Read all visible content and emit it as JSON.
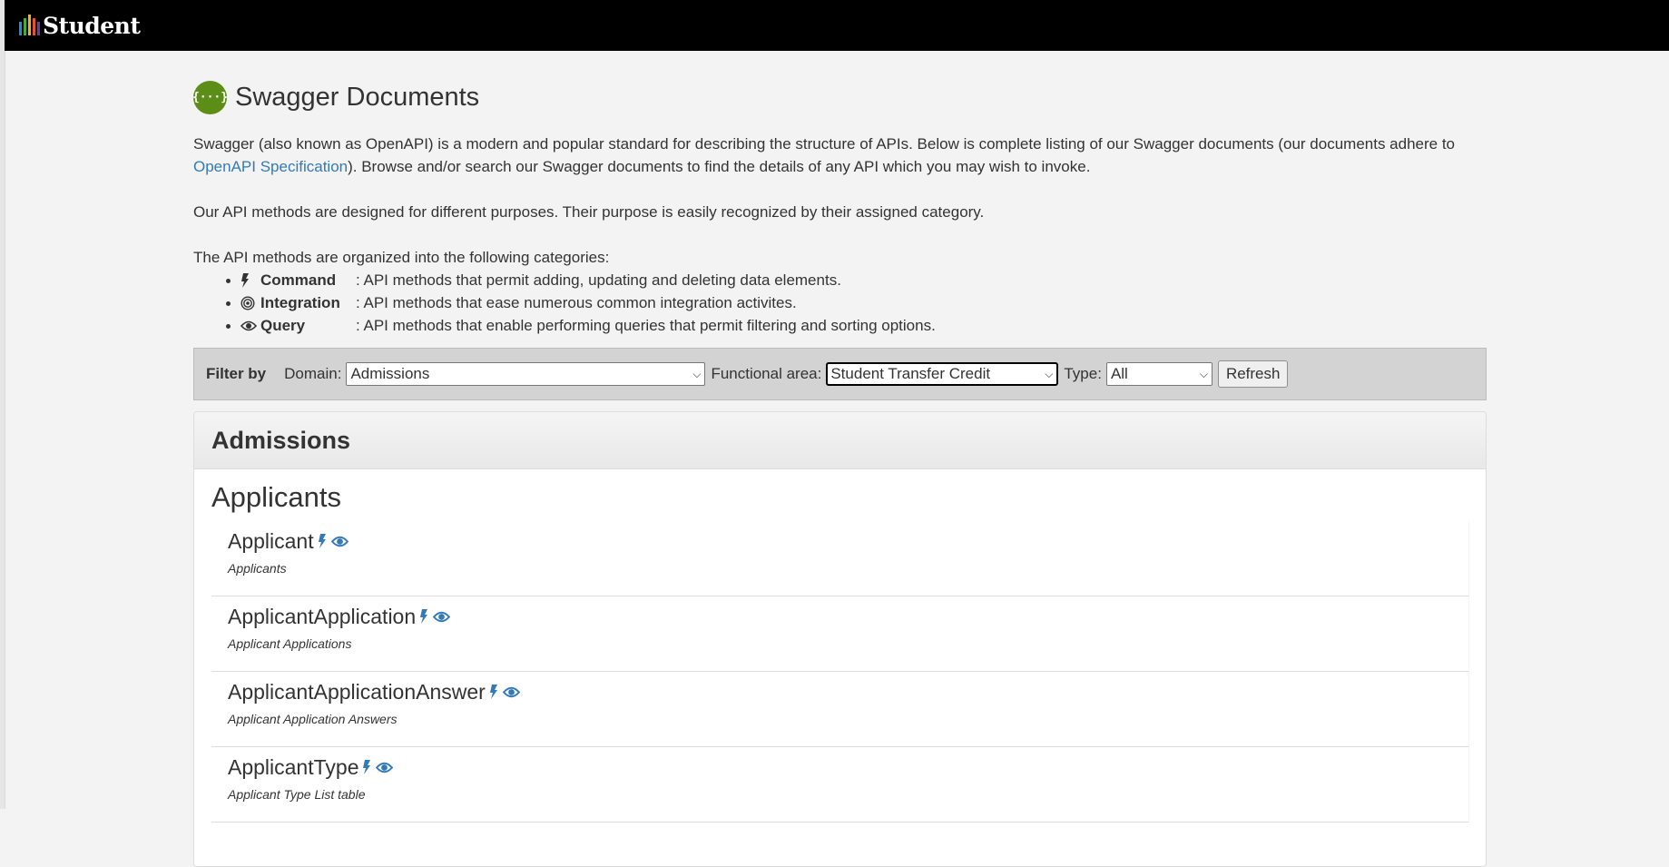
{
  "app": {
    "name": "Student",
    "logo_colors": [
      "#1e90d6",
      "#3fae3a",
      "#f2b418",
      "#e8542a",
      "#6a3fa0"
    ]
  },
  "page": {
    "title": "Swagger Documents",
    "icon": "swagger-braces-icon",
    "icon_text": "{···}",
    "accent_color": "#5b8d17",
    "intro_part1": "Swagger (also known as OpenAPI) is a modern and popular standard for describing the structure of APIs. Below is complete listing of our Swagger documents (our documents adhere to ",
    "intro_link": "OpenAPI Specification",
    "intro_part2": "). Browse and/or search our Swagger documents to find the details of any API which you may wish to invoke.",
    "purpose_text": "Our API methods are designed for different purposes. Their purpose is easily recognized by their assigned category.",
    "categories_intro": "The API methods are organized into the following categories:",
    "categories": [
      {
        "icon": "bolt-icon",
        "name": "Command",
        "description": ": API methods that permit adding, updating and deleting data elements."
      },
      {
        "icon": "target-icon",
        "name": "Integration",
        "description": ": API methods that ease numerous common integration activites."
      },
      {
        "icon": "eye-icon",
        "name": "Query",
        "description": ": API methods that enable performing queries that permit filtering and sorting options."
      }
    ]
  },
  "filter": {
    "label": "Filter by",
    "domain_label": "Domain:",
    "domain_value": "Admissions",
    "functional_area_label": "Functional area:",
    "functional_area_value": "Student Transfer Credit",
    "type_label": "Type:",
    "type_value": "All",
    "refresh_label": "Refresh"
  },
  "panel": {
    "heading": "Admissions",
    "group_title": "Applicants",
    "items": [
      {
        "name": "Applicant",
        "description": "Applicants",
        "icons": [
          "bolt-icon",
          "eye-icon"
        ]
      },
      {
        "name": "ApplicantApplication",
        "description": "Applicant Applications",
        "icons": [
          "bolt-icon",
          "eye-icon"
        ]
      },
      {
        "name": "ApplicantApplicationAnswer",
        "description": "Applicant Application Answers",
        "icons": [
          "bolt-icon",
          "eye-icon"
        ]
      },
      {
        "name": "ApplicantType",
        "description": "Applicant Type List table",
        "icons": [
          "bolt-icon",
          "eye-icon"
        ]
      }
    ]
  },
  "colors": {
    "link": "#337ab7",
    "header_bg": "#000000",
    "filter_bg": "#d3d3d3"
  }
}
